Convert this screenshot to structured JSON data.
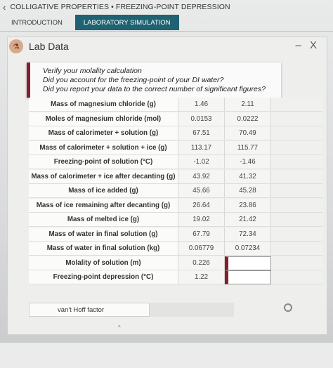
{
  "header": {
    "back_icon": "chevron-left-icon",
    "title": "COLLIGATIVE PROPERTIES • FREEZING-POINT DEPRESSION"
  },
  "tabs": [
    {
      "label": "INTRODUCTION",
      "active": false
    },
    {
      "label": "LABORATORY SIMULATION",
      "active": true
    }
  ],
  "panel": {
    "icon": "flask-icon",
    "title": "Lab Data",
    "controls": "– X"
  },
  "tooltip": {
    "line1": "Verify your molality calculation",
    "line2": "Did you account for the freezing-point of your DI water?",
    "line3": "Did you report your data to the correct number of significant figures?"
  },
  "rows": [
    {
      "label": "Mass of magnesium chloride (g)",
      "v1": "1.46",
      "v2": "2.11"
    },
    {
      "label": "Moles of magnesium chloride (mol)",
      "v1": "0.0153",
      "v2": "0.0222"
    },
    {
      "label": "Mass of calorimeter + solution (g)",
      "v1": "67.51",
      "v2": "70.49"
    },
    {
      "label": "Mass of calorimeter + solution + ice (g)",
      "v1": "113.17",
      "v2": "115.77"
    },
    {
      "label": "Freezing-point of solution (°C)",
      "v1": "-1.02",
      "v2": "-1.46"
    },
    {
      "label": "Mass of calorimeter + ice after decanting (g)",
      "v1": "43.92",
      "v2": "41.32"
    },
    {
      "label": "Mass of ice added (g)",
      "v1": "45.66",
      "v2": "45.28"
    },
    {
      "label": "Mass of ice remaining after decanting (g)",
      "v1": "26.64",
      "v2": "23.86"
    },
    {
      "label": "Mass of melted ice (g)",
      "v1": "19.02",
      "v2": "21.42"
    },
    {
      "label": "Mass of water in final solution (g)",
      "v1": "67.79",
      "v2": "72.34"
    },
    {
      "label": "Mass of water in final solution (kg)",
      "v1": "0.06779",
      "v2": "0.07234"
    },
    {
      "label": "Molality of solution (m)",
      "v1": "0.226",
      "v2": ""
    },
    {
      "label": "Freezing-point depression (°C)",
      "v1": "1.22",
      "v2": ""
    }
  ],
  "vant_hoff": {
    "label": "van't Hoff factor"
  },
  "colors": {
    "accent_tab": "#1f6272",
    "error_marker": "#8b1c2c"
  }
}
